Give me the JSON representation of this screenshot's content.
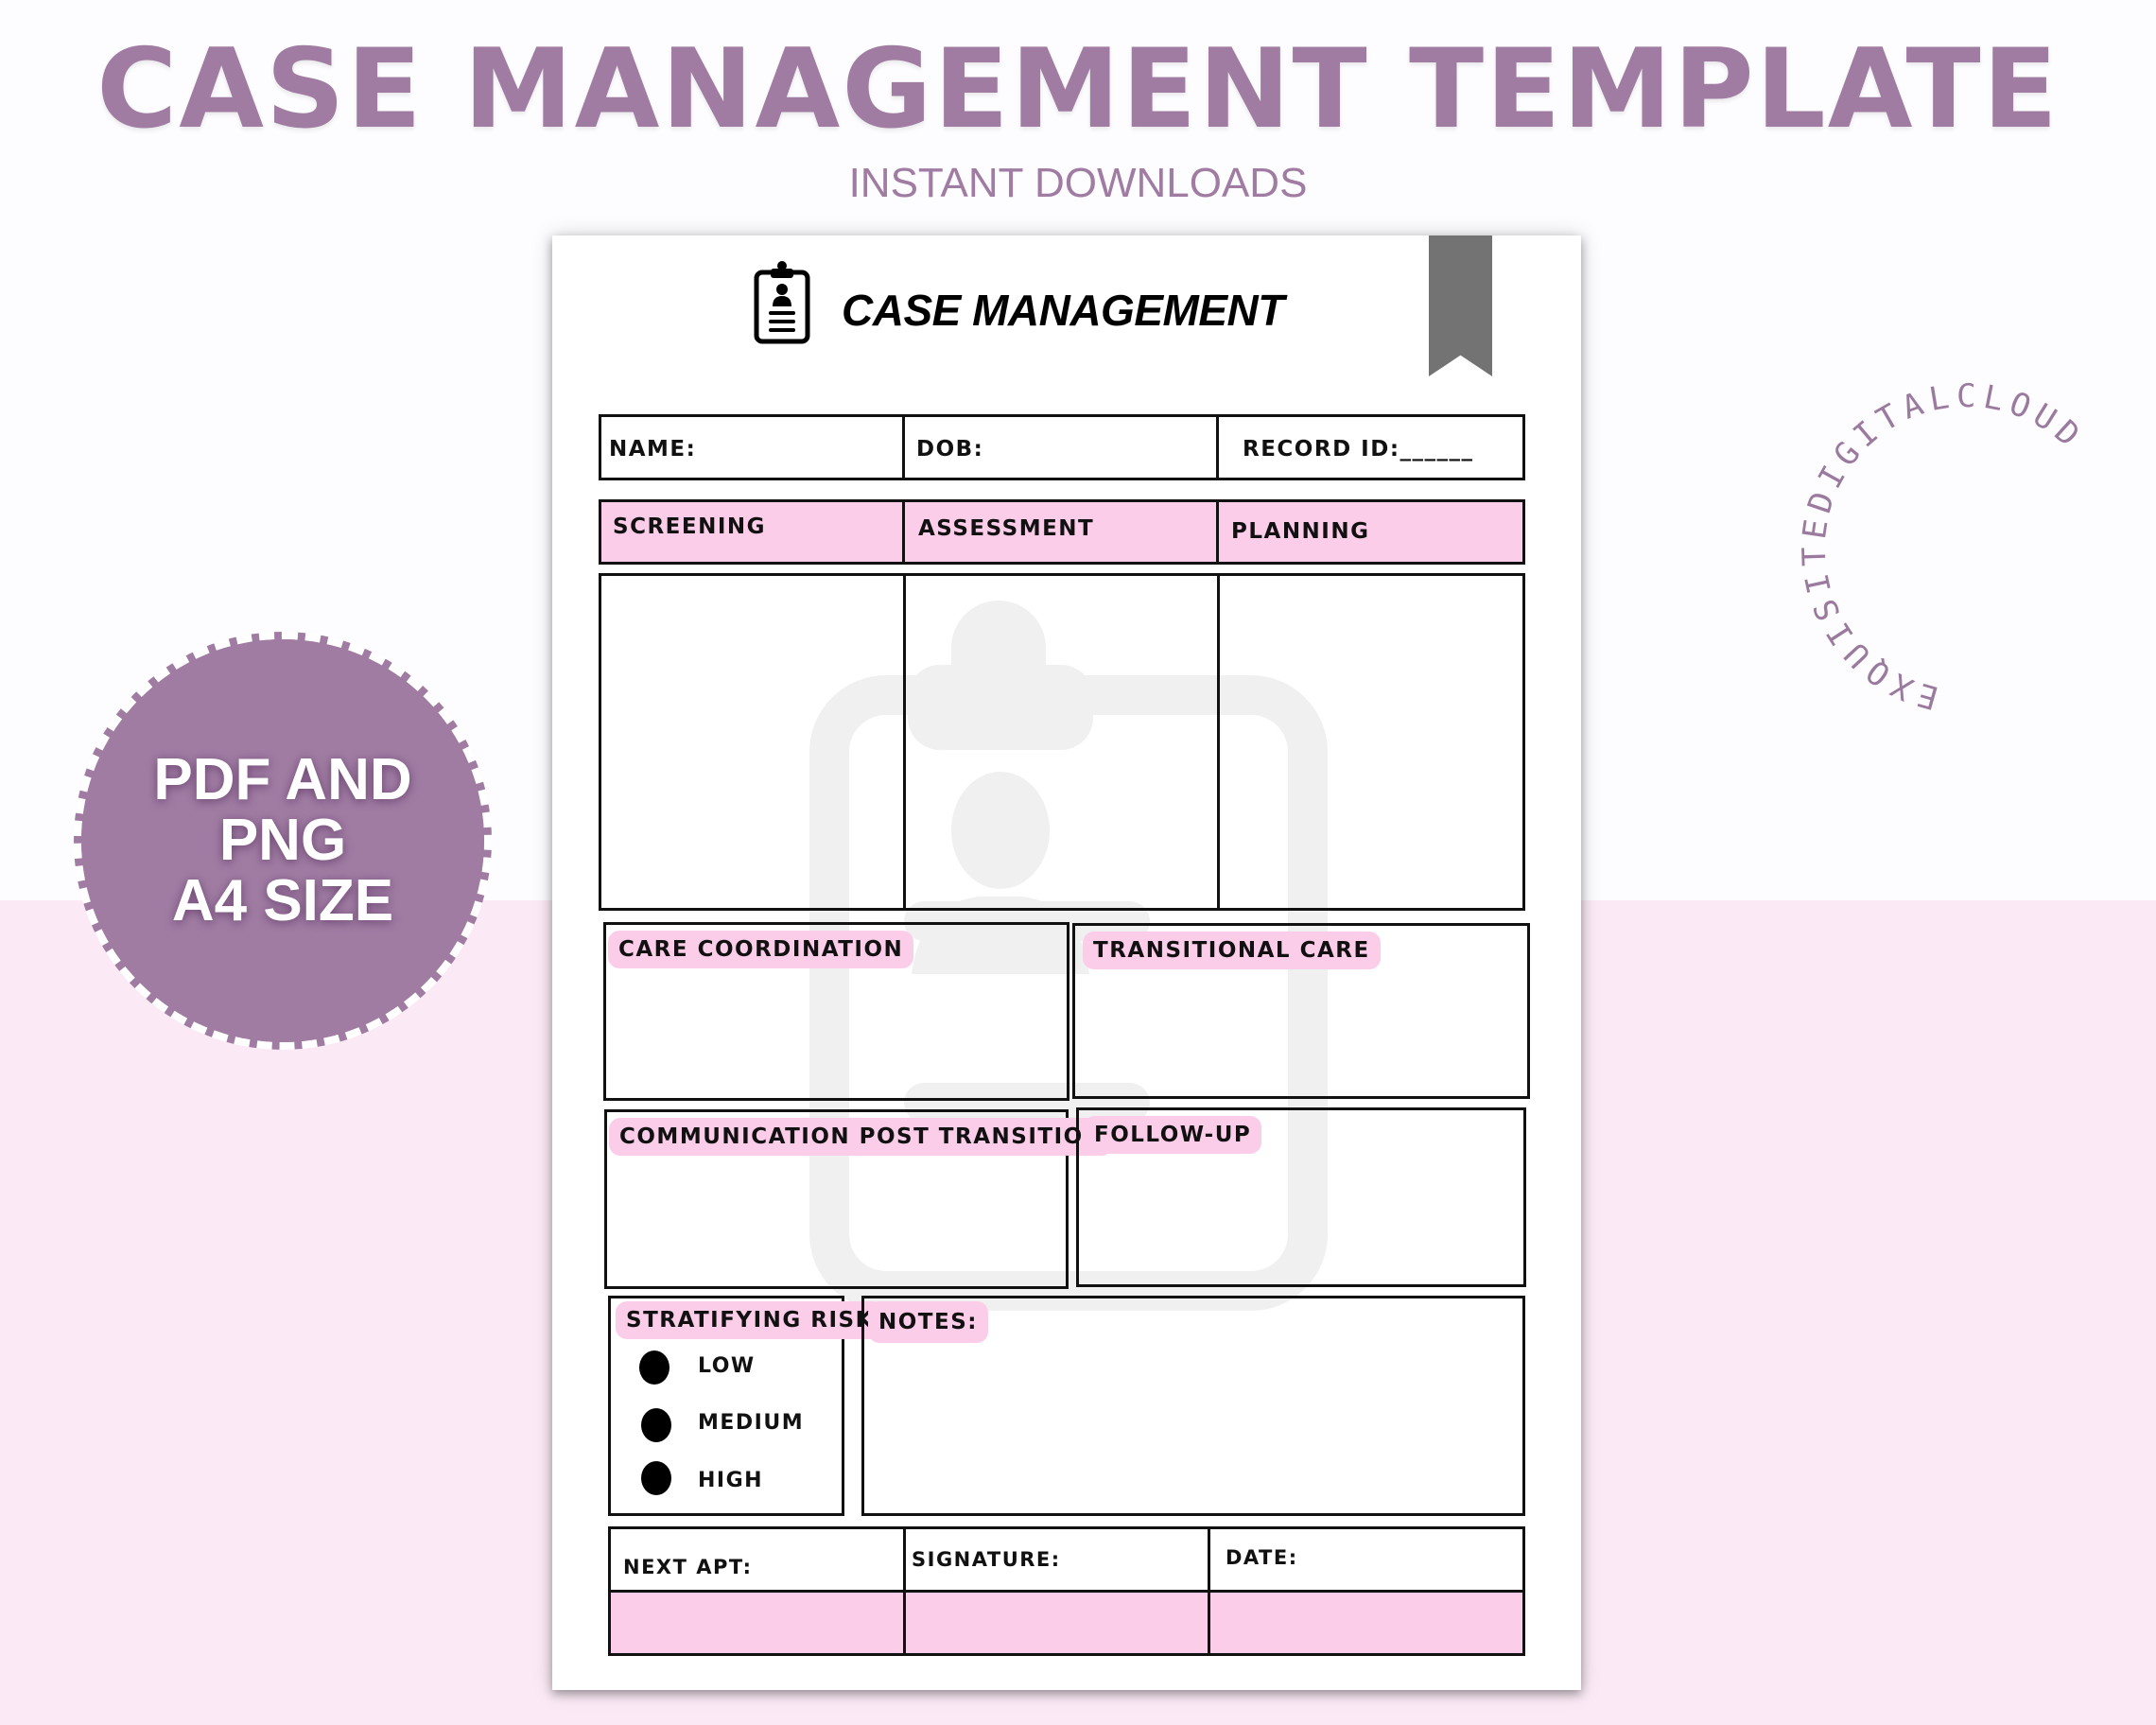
{
  "banner": {
    "title": "CASE MANAGEMENT TEMPLATE",
    "subtitle": "INSTANT DOWNLOADS",
    "accent_color": "#a07ca3",
    "pink_bg_color": "#fbeaf5"
  },
  "badge": {
    "lines": [
      "PDF AND",
      "PNG",
      "A4 SIZE"
    ]
  },
  "brand_ring": {
    "text": "EXQUISITEDIGITALCLOUD"
  },
  "document": {
    "title": "CASE MANAGEMENT",
    "header_icon": "clipboard-person-icon",
    "ribbon_icon": "bookmark-ribbon-icon",
    "watermark_icon": "clipboard-person-icon",
    "fill_color": "#fbcde9",
    "info_row": {
      "name": "NAME:",
      "dob": "DOB:",
      "record_id": "RECORD ID:______"
    },
    "stages": [
      "SCREENING",
      "ASSESSMENT",
      "PLANNING"
    ],
    "sections": {
      "care_coordination": "CARE COORDINATION",
      "transitional_care": "TRANSITIONAL CARE",
      "communication": "COMMUNICATION POST TRANSITION",
      "follow_up": "FOLLOW-UP"
    },
    "risk": {
      "title": "STRATIFYING RISK",
      "options": [
        "LOW",
        "MEDIUM",
        "HIGH"
      ]
    },
    "notes": "NOTES:",
    "footer": {
      "next_apt": "NEXT APT:",
      "signature": "SIGNATURE:",
      "date": "DATE:"
    }
  }
}
